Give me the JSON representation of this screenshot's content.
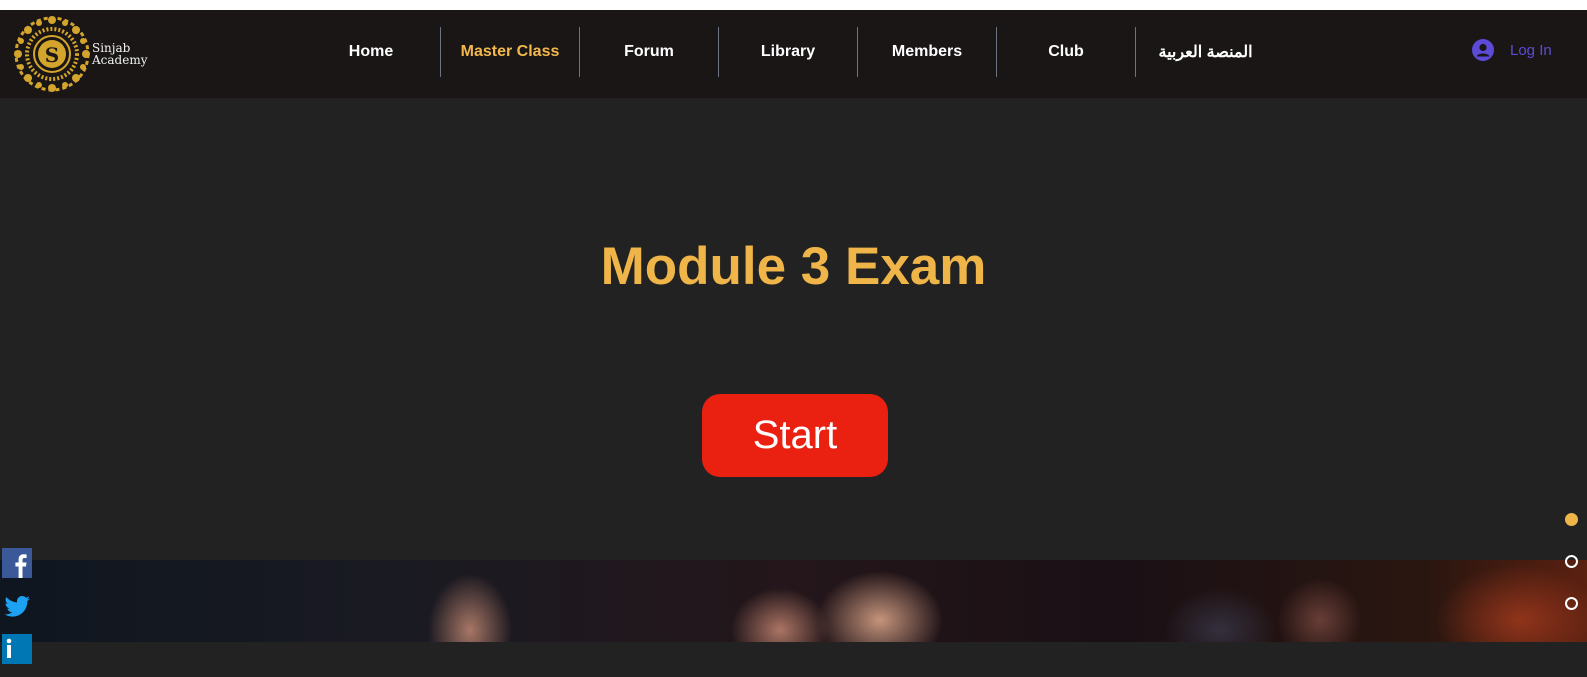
{
  "brand": {
    "logo_letter": "S",
    "name_line1": "Sinjab",
    "name_line2": "Academy",
    "gold": "#d4a52c"
  },
  "nav": {
    "items": [
      {
        "label": "Home",
        "active": false
      },
      {
        "label": "Master Class",
        "active": true
      },
      {
        "label": "Forum",
        "active": false
      },
      {
        "label": "Library",
        "active": false
      },
      {
        "label": "Members",
        "active": false
      },
      {
        "label": "Club",
        "active": false
      },
      {
        "label": "المنصة العربية",
        "active": false
      }
    ],
    "active_color": "#f2b84b"
  },
  "login": {
    "label": "Log In",
    "icon": "user-avatar-icon",
    "color": "#5b4bd8"
  },
  "hero": {
    "title": "Module 3 Exam",
    "title_color": "#efb548",
    "start_label": "Start",
    "button_color": "#ea2110"
  },
  "social": [
    {
      "icon": "facebook-icon",
      "color": "#3b5998"
    },
    {
      "icon": "twitter-icon",
      "color": "#1da1f2"
    },
    {
      "icon": "linkedin-icon",
      "color": "#0077b5"
    }
  ],
  "section_dots": {
    "count": 3,
    "active_index": 0,
    "active_color": "#efb548"
  }
}
